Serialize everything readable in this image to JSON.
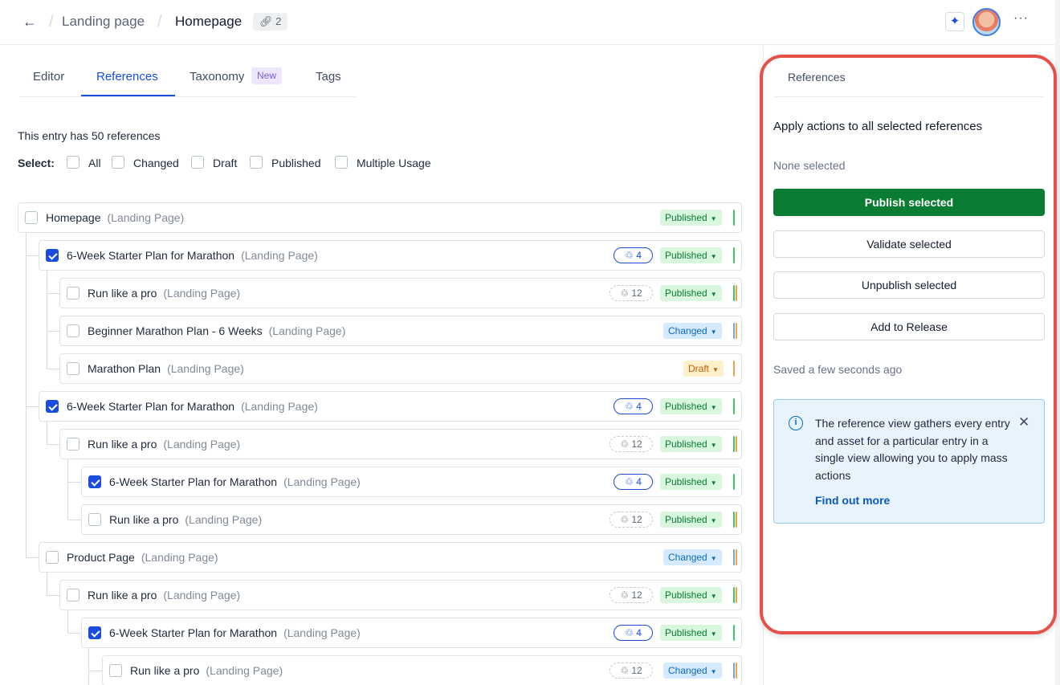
{
  "header": {
    "back_icon": "arrow-left-icon",
    "breadcrumb_parent": "Landing page",
    "breadcrumb_current": "Homepage",
    "references_badge": "2",
    "more_label": "···"
  },
  "tabs": [
    {
      "label": "Editor"
    },
    {
      "label": "References",
      "active": true
    },
    {
      "label": "Taxonomy",
      "badge": "New"
    },
    {
      "label": "Tags"
    }
  ],
  "entry_count_text": "This entry has 50 references",
  "select": {
    "label": "Select:",
    "options": [
      "All",
      "Changed",
      "Draft",
      "Published",
      "Multiple Usage"
    ]
  },
  "rows": [
    {
      "title": "Homepage",
      "type": "(Landing Page)",
      "checked": false,
      "usage": "",
      "status": "Published"
    },
    {
      "title": "6-Week Starter Plan for Marathon",
      "type": "(Landing Page)",
      "checked": true,
      "usage": "4",
      "status": "Published"
    },
    {
      "title": "Run like a pro",
      "type": "(Landing Page)",
      "checked": false,
      "usage": "12",
      "status": "Published"
    },
    {
      "title": "Beginner Marathon Plan - 6 Weeks",
      "type": "(Landing Page)",
      "checked": false,
      "usage": "",
      "status": "Changed"
    },
    {
      "title": "Marathon Plan",
      "type": "(Landing Page)",
      "checked": false,
      "usage": "",
      "status": "Draft"
    },
    {
      "title": "6-Week Starter Plan for Marathon",
      "type": "(Landing Page)",
      "checked": true,
      "usage": "4",
      "status": "Published"
    },
    {
      "title": "Run like a pro",
      "type": "(Landing Page)",
      "checked": false,
      "usage": "12",
      "status": "Published"
    },
    {
      "title": "6-Week Starter Plan for Marathon",
      "type": "(Landing Page)",
      "checked": true,
      "usage": "4",
      "status": "Published"
    },
    {
      "title": "Run like a pro",
      "type": "(Landing Page)",
      "checked": false,
      "usage": "12",
      "status": "Published"
    },
    {
      "title": "Product Page",
      "type": "(Landing Page)",
      "checked": false,
      "usage": "",
      "status": "Changed"
    },
    {
      "title": "Run like a pro",
      "type": "(Landing Page)",
      "checked": false,
      "usage": "12",
      "status": "Published"
    },
    {
      "title": "6-Week Starter Plan for Marathon",
      "type": "(Landing Page)",
      "checked": true,
      "usage": "4",
      "status": "Published"
    },
    {
      "title": "Run like a pro",
      "type": "(Landing Page)",
      "checked": false,
      "usage": "12",
      "status": "Changed"
    }
  ],
  "panel": {
    "title": "References",
    "heading": "Apply actions to all selected references",
    "none_selected": "None selected",
    "publish_button": "Publish selected",
    "validate_button": "Validate selected",
    "unpublish_button": "Unpublish selected",
    "release_button": "Add to Release",
    "saved_text": "Saved a few seconds ago",
    "note_text": "The reference view gathers every entry and asset for a particular entry in a single view allowing you to apply mass actions",
    "note_link": "Find out more"
  },
  "colors": {
    "accent_blue": "#1b4ce0",
    "publish_green": "#0a7d33",
    "highlight_red": "#e5504a",
    "published_bg": "#d9f7dd",
    "changed_bg": "#d6eaff",
    "draft_bg": "#fff0cc"
  }
}
